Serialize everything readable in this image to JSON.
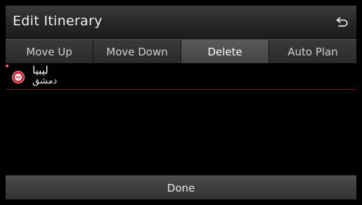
{
  "header": {
    "title": "Edit Itinerary",
    "back_icon": "back-arrow-icon"
  },
  "tabs": [
    {
      "label": "Move Up",
      "active": false
    },
    {
      "label": "Move Down",
      "active": false
    },
    {
      "label": "Delete",
      "active": true
    },
    {
      "label": "Auto Plan",
      "active": false
    }
  ],
  "items": [
    {
      "title": "ليبيا",
      "subtitle": "دمشق",
      "icon": "destination-pin-icon",
      "selected": true
    }
  ],
  "footer": {
    "done_label": "Done"
  },
  "colors": {
    "accent": "#7a1e26",
    "selected_dot": "#ff5a6a"
  }
}
